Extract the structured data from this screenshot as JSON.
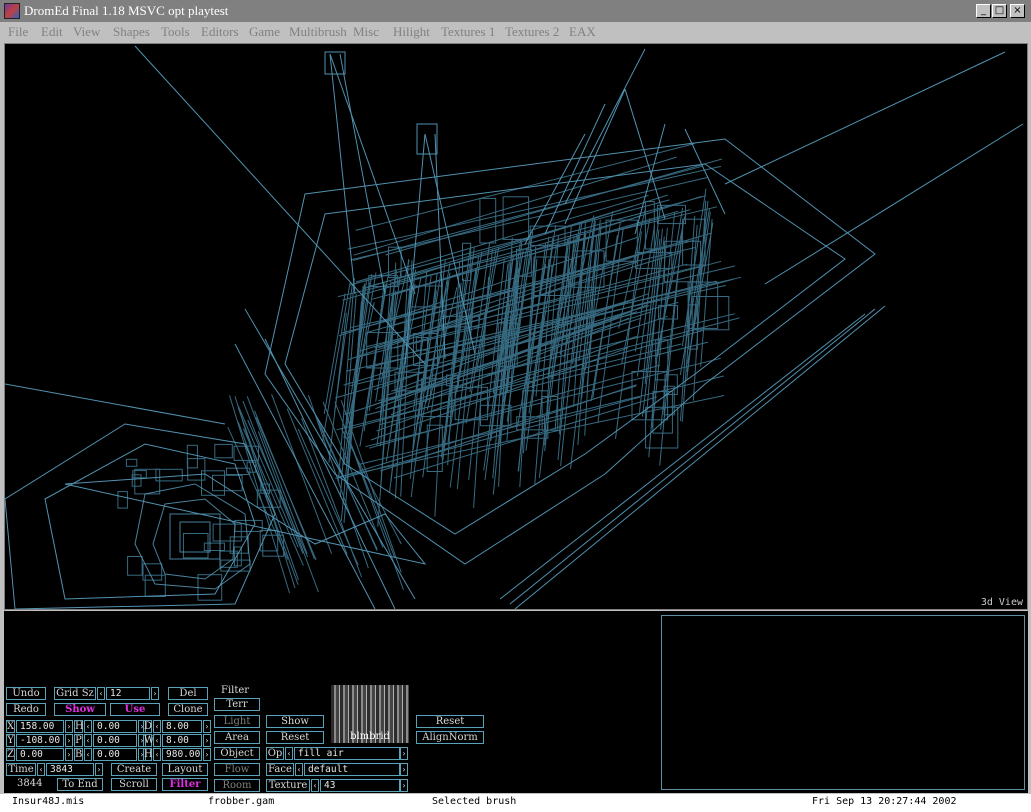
{
  "window": {
    "title": "DromEd Final 1.18 MSVC opt playtest"
  },
  "menu": [
    "File",
    "Edit",
    "View",
    "Shapes",
    "Tools",
    "Editors",
    "Game",
    "Multibrush",
    "Misc",
    "Hilight",
    "Textures 1",
    "Textures 2",
    "EAX"
  ],
  "view3d": {
    "label": "3d View",
    "wire_color": "#5aa2c4"
  },
  "controls": {
    "undo": "Undo",
    "redo": "Redo",
    "grid_sz_label": "Grid Sz",
    "grid_sz_value": "12",
    "del": "Del",
    "clone": "Clone",
    "show": "Show",
    "use": "Use",
    "filter_title": "Filter",
    "terr": "Terr",
    "light": "Light",
    "area": "Area",
    "object": "Object",
    "flow": "Flow",
    "room": "Room",
    "show2": "Show",
    "reset2": "Reset",
    "x_label": "X",
    "x_value": "158.00",
    "y_label": "Y",
    "y_value": "-108.00",
    "z_label": "Z",
    "z_value": "0.00",
    "h_label": "H",
    "h_value": "0.00",
    "p_label": "P",
    "p_value": "0.00",
    "b_label": "B",
    "b_value": "0.00",
    "d_label": "D",
    "d_value": "8.00",
    "w_label": "W",
    "w_value": "8.00",
    "hh_label": "H",
    "hh_value": "980.00",
    "time_label": "Time",
    "time_value": "3843",
    "time_count": "3844",
    "create": "Create",
    "layout": "Layout",
    "to_end": "To End",
    "scroll": "Scroll",
    "filter": "Filter",
    "op_label": "Op",
    "op_value": "fill air",
    "face_label": "Face",
    "face_value": "default",
    "texture_label": "Texture",
    "texture_value": "43",
    "texture_name": "blmbrid",
    "reset_right": "Reset",
    "align_norm": "AlignNorm"
  },
  "status": {
    "mission": "Insur48J.mis",
    "gamesys": "frobber.gam",
    "selection": "Selected brush",
    "datetime": "Fri Sep 13 20:27:44 2002"
  }
}
